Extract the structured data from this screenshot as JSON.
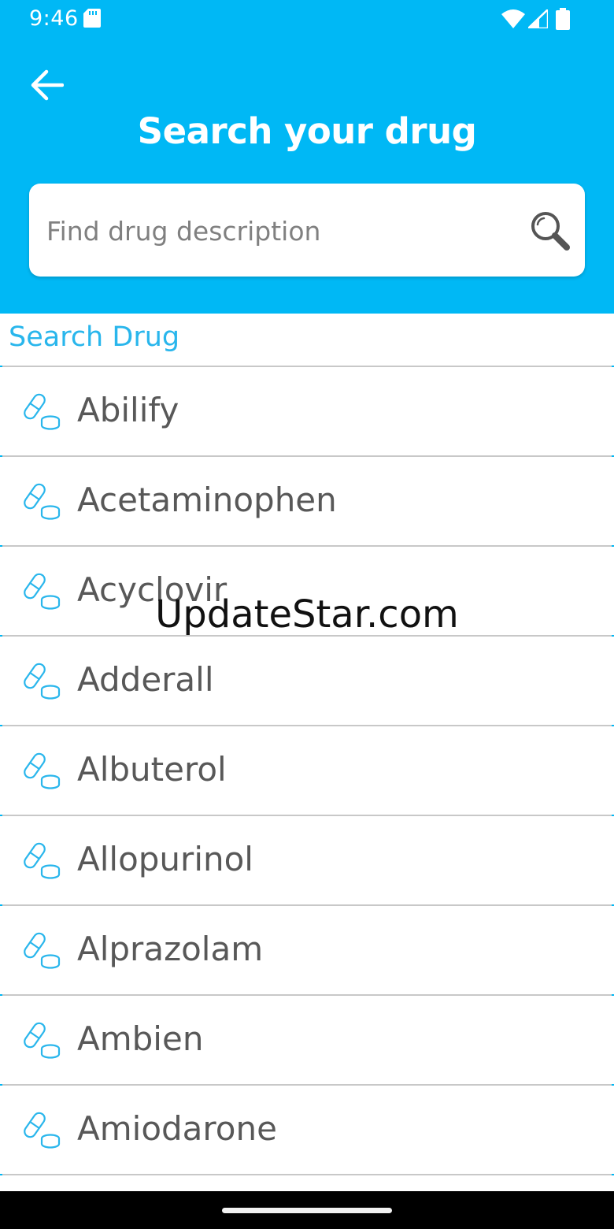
{
  "status_bar": {
    "time": "9:46",
    "icons": [
      "sd-card-icon",
      "wifi-icon",
      "signal-icon",
      "battery-icon"
    ]
  },
  "header": {
    "back_icon": "arrow-left-icon",
    "title": "Search your drug",
    "search": {
      "placeholder": "Find drug description",
      "value": "",
      "icon": "search-icon"
    }
  },
  "section_label": "Search Drug",
  "drugs": [
    "Abilify",
    "Acetaminophen",
    "Acyclovir",
    "Adderall",
    "Albuterol",
    "Allopurinol",
    "Alprazolam",
    "Ambien",
    "Amiodarone"
  ],
  "item_icon": "pill-icon",
  "watermark": "UpdateStar.com",
  "colors": {
    "header_bg": "#00b8f5",
    "accent": "#29b6ec",
    "divider": "#c8c8c8",
    "text": "#585858"
  }
}
